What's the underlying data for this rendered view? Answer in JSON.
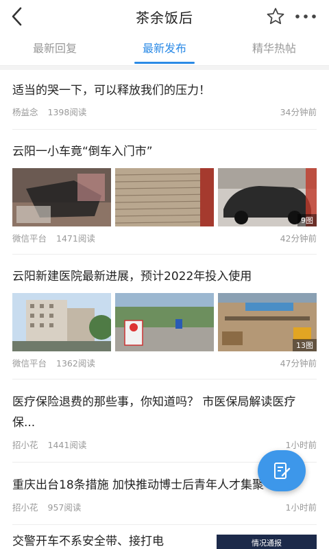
{
  "header": {
    "title": "茶余饭后"
  },
  "tabs": [
    {
      "label": "最新回复",
      "active": false
    },
    {
      "label": "最新发布",
      "active": true
    },
    {
      "label": "精华热帖",
      "active": false
    }
  ],
  "posts": [
    {
      "title": "适当的哭一下，可以释放我们的压力！",
      "author": "杨益念",
      "views": "1398阅读",
      "time": "34分钟前"
    },
    {
      "title": "云阳一小车竟“倒车入门市”",
      "author": "微信平台",
      "views": "1471阅读",
      "time": "42分钟前",
      "image_count": "9图"
    },
    {
      "title": "云阳新建医院最新进展，预计2022年投入使用",
      "author": "微信平台",
      "views": "1362阅读",
      "time": "47分钟前",
      "image_count": "13图"
    },
    {
      "title": "医疗保险退费的那些事，你知道吗？ 市医保局解读医疗保...",
      "author": "招小花",
      "views": "1441阅读",
      "time": "1小时前"
    },
    {
      "title": "重庆出台18条措施 加快推动博士后青年人才集聚",
      "author": "招小花",
      "views": "957阅读",
      "time": "1小时前"
    },
    {
      "title": "交警开车不系安全带、接打电",
      "side_image_caption": "情况通报"
    }
  ],
  "colors": {
    "accent": "#2b8ae6",
    "fab": "#3d97ea"
  },
  "icons": {
    "back": "chevron-left-icon",
    "favorite": "star-icon",
    "more": "more-dots-icon",
    "compose": "edit-icon"
  }
}
